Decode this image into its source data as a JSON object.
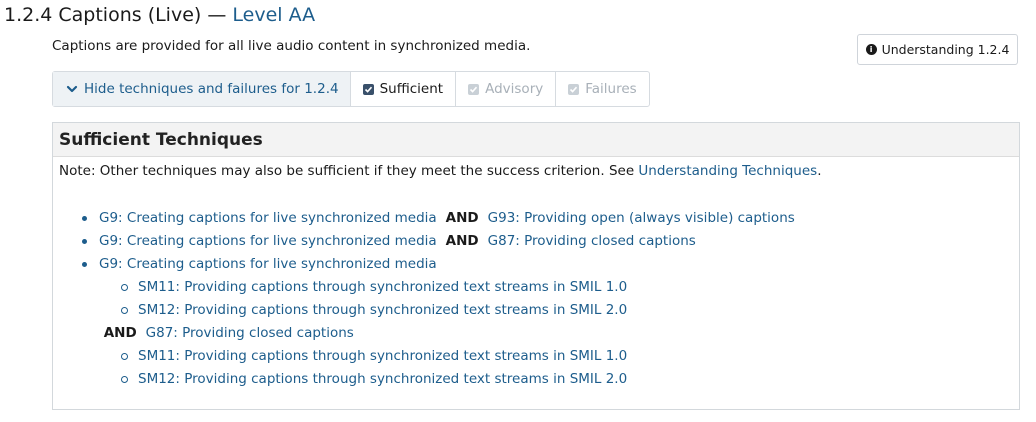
{
  "header": {
    "title_prefix": "1.2.4 Captions (Live) — ",
    "level": "Level AA",
    "description": "Captions are provided for all live audio content in synchronized media."
  },
  "understanding_button": {
    "icon": "info-icon",
    "label": "Understanding 1.2.4"
  },
  "toggles": {
    "hide_label": "Hide techniques and failures for 1.2.4",
    "sufficient_label": "Sufficient",
    "advisory_label": "Advisory",
    "failures_label": "Failures",
    "sufficient_checked": true,
    "advisory_checked": true,
    "failures_checked": true
  },
  "panel": {
    "heading": "Sufficient Techniques",
    "note_prefix": "Note: Other techniques may also be sufficient if they meet the success criterion. See ",
    "note_link": "Understanding Techniques",
    "note_suffix": "."
  },
  "techniques": {
    "item1": {
      "a": "G9: Creating captions for live synchronized media",
      "and": "AND",
      "b": "G93: Providing open (always visible) captions"
    },
    "item2": {
      "a": "G9: Creating captions for live synchronized media",
      "and": "AND",
      "b": "G87: Providing closed captions"
    },
    "item3": {
      "a": "G9: Creating captions for live synchronized media",
      "sub1": [
        "SM11: Providing captions through synchronized text streams in SMIL 1.0",
        "SM12: Providing captions through synchronized text streams in SMIL 2.0"
      ],
      "and": "AND",
      "b": "G87: Providing closed captions",
      "sub2": [
        "SM11: Providing captions through synchronized text streams in SMIL 1.0",
        "SM12: Providing captions through synchronized text streams in SMIL 2.0"
      ]
    }
  },
  "colors": {
    "link": "#1d5d8c",
    "disabled": "#a8b0b8",
    "panel_header_bg": "#f3f3f3"
  }
}
